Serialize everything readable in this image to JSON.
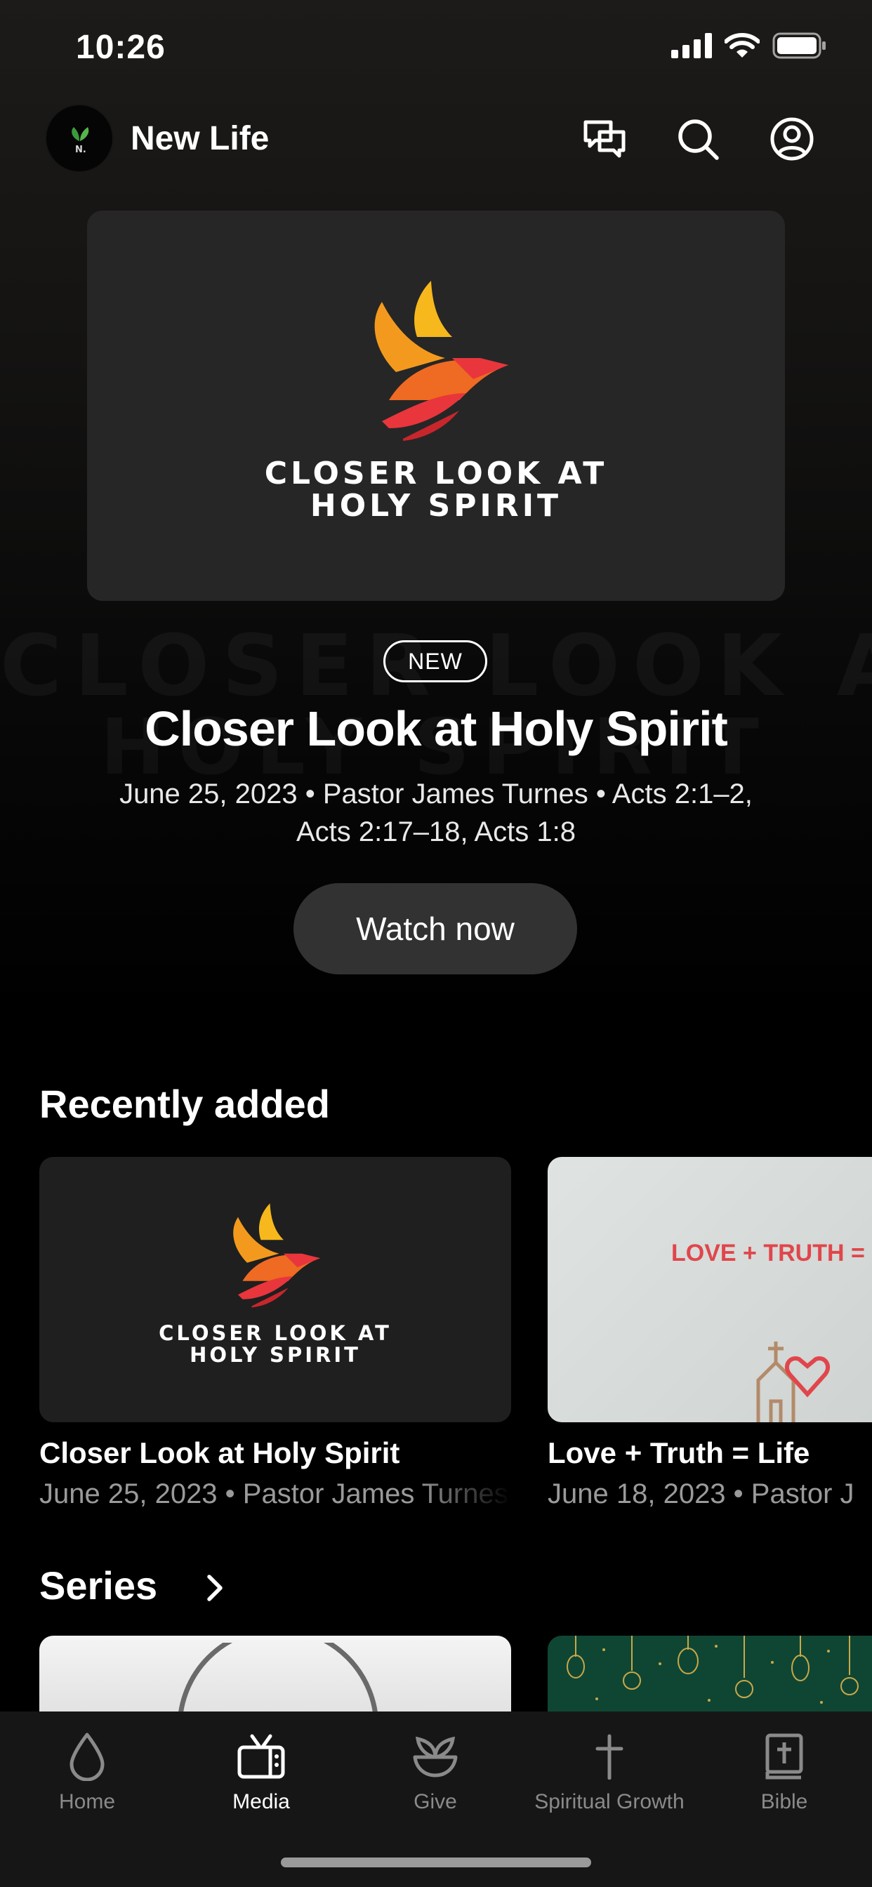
{
  "status_bar": {
    "time": "10:26"
  },
  "header": {
    "app_name": "New Life",
    "logo_text": "N."
  },
  "hero": {
    "art_title_line1": "CLOSER LOOK AT",
    "art_title_line2": "HOLY SPIRIT",
    "badge": "NEW",
    "title": "Closer Look at Holy Spirit",
    "meta_line1": "June 25, 2023 • Pastor James Turnes • Acts 2:1–2,",
    "meta_line2": "Acts 2:17–18, Acts 1:8",
    "watch_button": "Watch now"
  },
  "recently_added": {
    "title": "Recently added",
    "items": [
      {
        "title": "Closer Look at Holy Spirit",
        "meta": "June 25, 2023 • Pastor James Turnes",
        "art_line1": "CLOSER LOOK AT",
        "art_line2": "HOLY SPIRIT"
      },
      {
        "title": "Love + Truth = Life",
        "meta": "June 18, 2023 • Pastor J",
        "art_text": "LOVE + TRUTH = LI"
      }
    ]
  },
  "series": {
    "title": "Series"
  },
  "tab_bar": {
    "tabs": [
      {
        "label": "Home",
        "icon": "drop-icon",
        "active": false
      },
      {
        "label": "Media",
        "icon": "tv-icon",
        "active": true
      },
      {
        "label": "Give",
        "icon": "plant-bowl-icon",
        "active": false
      },
      {
        "label": "Spiritual Growth",
        "icon": "cross-icon",
        "active": false
      },
      {
        "label": "Bible",
        "icon": "bible-icon",
        "active": false
      }
    ]
  },
  "colors": {
    "background": "#000000",
    "card": "#262626",
    "button": "#323232",
    "accent_red": "#e8363c",
    "accent_orange": "#f39a1e"
  }
}
